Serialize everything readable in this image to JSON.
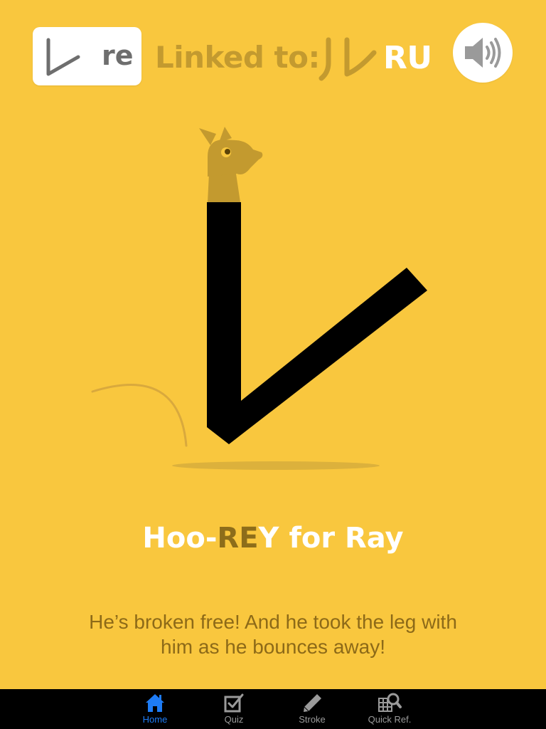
{
  "header": {
    "kana": "レ",
    "romaji": "re",
    "linked_label": "Linked to:",
    "linked_kana": "ル",
    "linked_romaji": "RU",
    "sound_icon": "speaker-icon"
  },
  "mnemonic": {
    "title_prefix": "Hoo-",
    "title_highlight": "RE",
    "title_suffix": "Y for Ray",
    "description": "He’s broken free! And he took the leg with him as he bounces away!"
  },
  "tabs": [
    {
      "label": "Home",
      "icon": "home-icon",
      "active": true
    },
    {
      "label": "Quiz",
      "icon": "quiz-checkbox-icon",
      "active": false
    },
    {
      "label": "Stroke",
      "icon": "pencil-icon",
      "active": false
    },
    {
      "label": "Quick Ref.",
      "icon": "grid-search-icon",
      "active": false
    }
  ],
  "colors": {
    "background": "#f9c73e",
    "accent_dark": "#c39a2f",
    "text_brown": "#8d6a18",
    "tab_active": "#1e7cf5",
    "tab_inactive": "#9a9a9a"
  }
}
